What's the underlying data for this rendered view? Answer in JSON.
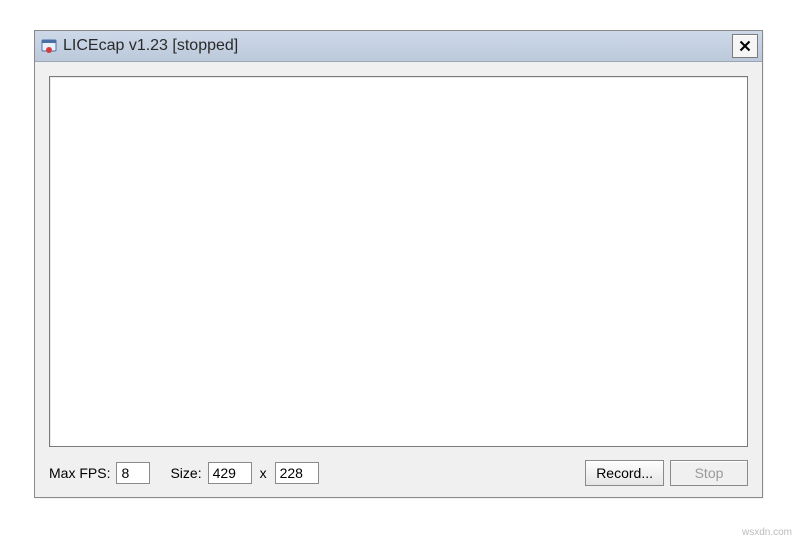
{
  "window": {
    "title": "LICEcap v1.23 [stopped]"
  },
  "controls": {
    "max_fps_label": "Max FPS:",
    "max_fps_value": "8",
    "size_label": "Size:",
    "width_value": "429",
    "times_symbol": "x",
    "height_value": "228",
    "record_label": "Record...",
    "stop_label": "Stop",
    "stop_disabled": true
  },
  "watermark": "wsxdn.com"
}
